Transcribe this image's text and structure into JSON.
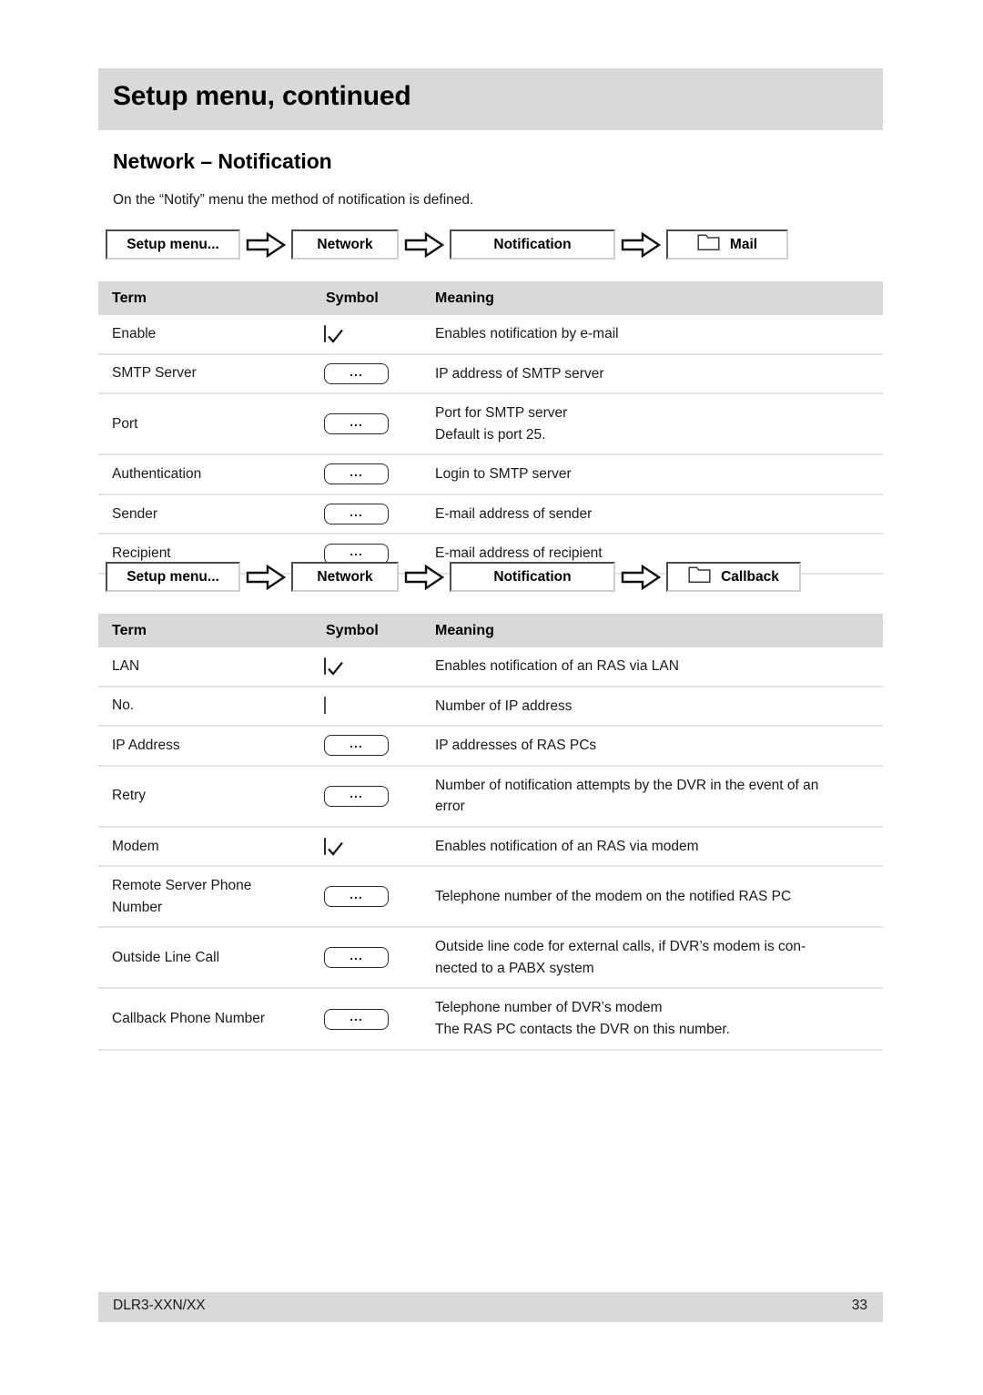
{
  "header": {
    "running_title": "Setup menu, continued"
  },
  "section": {
    "title": "Network – Notification",
    "intro": "On the “Notify” menu the method of notification is defined."
  },
  "breadcrumbs": [
    {
      "id": "mail-path",
      "steps": [
        "Setup menu...",
        "Network",
        "Notification",
        "Mail"
      ],
      "leaf_icon": "folder-icon"
    },
    {
      "id": "callback-path",
      "steps": [
        "Setup menu...",
        "Network",
        "Notification",
        "Callback"
      ],
      "leaf_icon": "folder-icon"
    }
  ],
  "tables": [
    {
      "id": "mail-table",
      "columns": [
        "Term",
        "Symbol",
        "Meaning"
      ],
      "rows": [
        {
          "term": "Enable",
          "symbol": "checkbox-checked",
          "meaning": [
            "Enables notification by e-mail"
          ]
        },
        {
          "term": "SMTP Server",
          "symbol": "ellipsis-button",
          "meaning": [
            "IP address of SMTP server"
          ]
        },
        {
          "term": "Port",
          "symbol": "ellipsis-button",
          "meaning": [
            "Port for SMTP server",
            "Default is port 25."
          ]
        },
        {
          "term": "Authentication",
          "symbol": "ellipsis-button",
          "meaning": [
            "Login to SMTP server"
          ]
        },
        {
          "term": "Sender",
          "symbol": "ellipsis-button",
          "meaning": [
            "E-mail address of sender"
          ]
        },
        {
          "term": "Recipient",
          "symbol": "ellipsis-button",
          "meaning": [
            "E-mail address of recipient"
          ]
        }
      ]
    },
    {
      "id": "callback-table",
      "columns": [
        "Term",
        "Symbol",
        "Meaning"
      ],
      "rows": [
        {
          "term": "LAN",
          "symbol": "checkbox-checked",
          "meaning": [
            "Enables notification of an RAS via LAN"
          ]
        },
        {
          "term": "No.",
          "symbol": "blank-field",
          "meaning": [
            "Number of IP address"
          ]
        },
        {
          "term": "IP Address",
          "symbol": "ellipsis-button",
          "meaning": [
            "IP addresses of RAS PCs"
          ]
        },
        {
          "term": "Retry",
          "symbol": "ellipsis-button",
          "meaning": [
            "Number of notification attempts by the DVR in the event of an",
            "error"
          ]
        },
        {
          "term": "Modem",
          "symbol": "checkbox-checked",
          "meaning": [
            "Enables notification of an RAS via modem"
          ]
        },
        {
          "term": "Remote Server Phone Number",
          "term_lines": [
            "Remote Server Phone",
            "Number"
          ],
          "symbol": "ellipsis-button",
          "meaning": [
            "Telephone number of the modem on the notified RAS PC"
          ]
        },
        {
          "term": "Outside Line Call",
          "symbol": "ellipsis-button",
          "meaning": [
            "Outside line code for external calls, if DVR’s modem is con-",
            "nected to a PABX system"
          ]
        },
        {
          "term": "Callback Phone Number",
          "symbol": "ellipsis-button",
          "meaning": [
            "Telephone number of DVR’s modem",
            "The RAS PC contacts the DVR on this number."
          ]
        }
      ]
    }
  ],
  "ellipsis_label": "...",
  "footer": {
    "model": "DLR3-XXN/XX",
    "page_number": "33"
  },
  "colors": {
    "band_gray": "#d8d9da",
    "rule_gray": "#e3e4e5",
    "text": "#1a1a1a"
  }
}
